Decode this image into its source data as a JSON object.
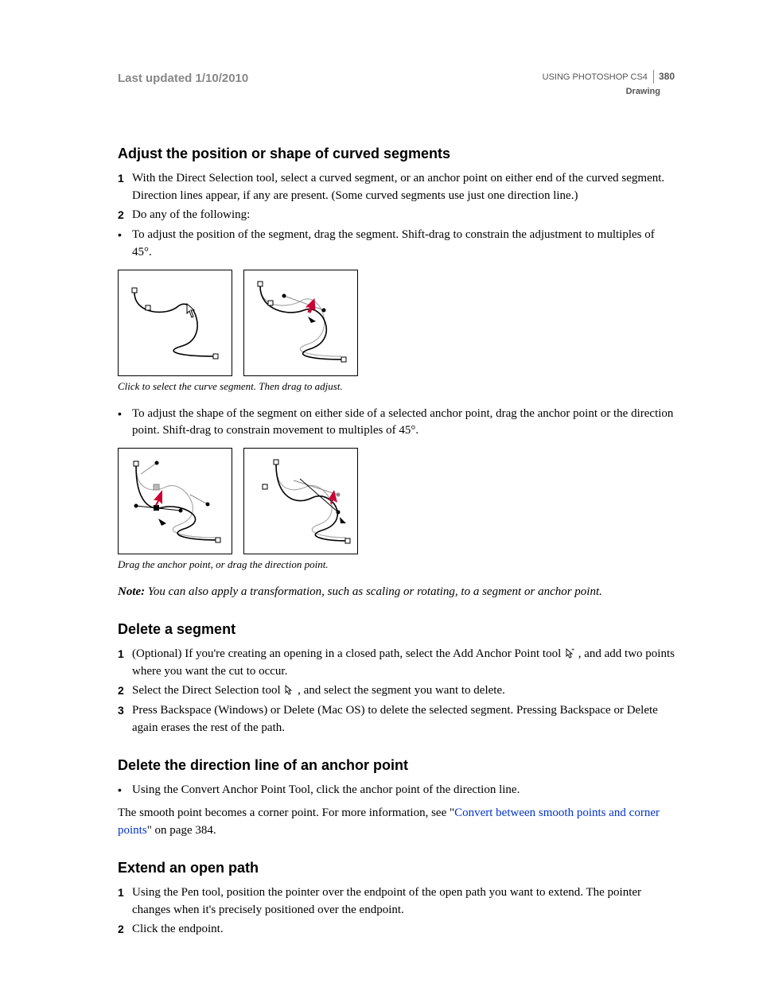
{
  "header": {
    "last_updated_label": "Last updated 1/10/2010",
    "product": "USING PHOTOSHOP CS4",
    "page_number": "380",
    "section": "Drawing"
  },
  "sec1": {
    "title": "Adjust the position or shape of curved segments",
    "step1": "With the Direct Selection tool, select a curved segment, or an anchor point on either end of the curved segment. Direction lines appear, if any are present. (Some curved segments use just one direction line.)",
    "step2": "Do any of the following:",
    "bullet1": "To adjust the position of the segment, drag the segment. Shift-drag to constrain the adjustment to multiples of 45°.",
    "caption1": "Click to select the curve segment. Then drag to adjust.",
    "bullet2": "To adjust the shape of the segment on either side of a selected anchor point, drag the anchor point or the direction point. Shift-drag to constrain movement to multiples of 45°.",
    "caption2": "Drag the anchor point, or drag the direction point.",
    "note_label": "Note:",
    "note_text": " You can also apply a transformation, such as scaling or rotating, to a segment or anchor point."
  },
  "sec2": {
    "title": "Delete a segment",
    "step1_a": "(Optional) If you're creating an opening in a closed path, select the Add Anchor Point tool ",
    "step1_b": ", and add two points where you want the cut to occur.",
    "step2_a": "Select the Direct Selection tool ",
    "step2_b": ", and select the segment you want to delete.",
    "step3": "Press Backspace (Windows) or Delete (Mac OS) to delete the selected segment. Pressing Backspace or Delete again erases the rest of the path."
  },
  "sec3": {
    "title": "Delete the direction line of an anchor point",
    "bullet1": "Using the Convert Anchor Point Tool, click the anchor point of the direction line.",
    "para_a": "The smooth point becomes a corner point. For more information, see \"",
    "link": "Convert between smooth points and corner points",
    "para_b": "\" on page 384."
  },
  "sec4": {
    "title": "Extend an open path",
    "step1": "Using the Pen tool, position the pointer over the endpoint of the open path you want to extend. The pointer changes when it's precisely positioned over the endpoint.",
    "step2": "Click the endpoint."
  }
}
